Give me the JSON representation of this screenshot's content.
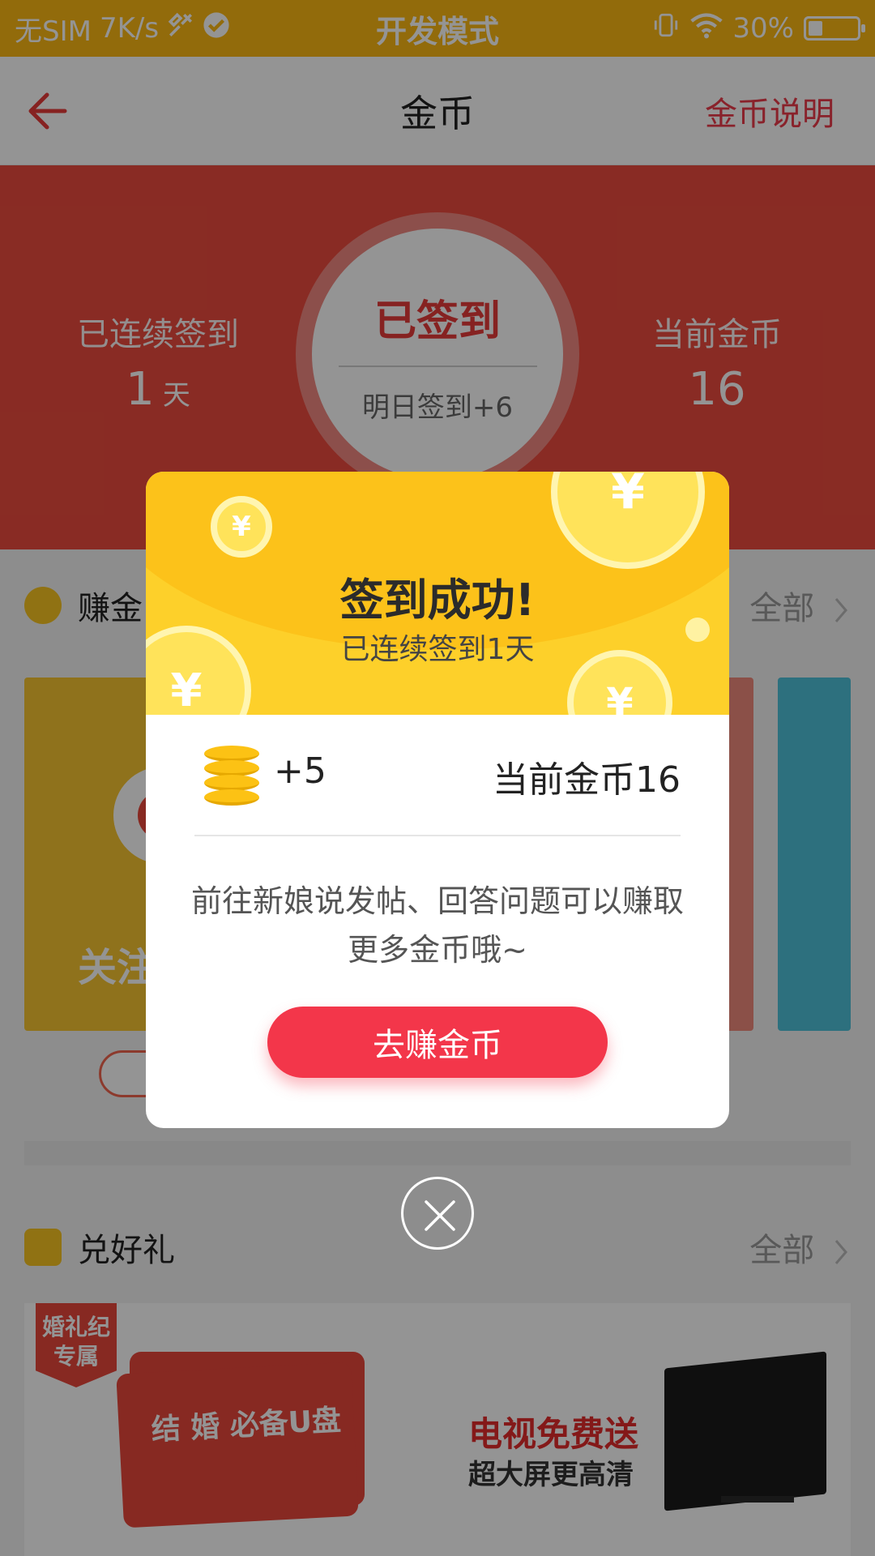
{
  "status_bar": {
    "carrier": "无SIM",
    "speed": "7K/s",
    "mode": "开发模式",
    "battery": "30%",
    "battery_level": 0.3
  },
  "nav": {
    "title": "金币",
    "right_link": "金币说明"
  },
  "hero": {
    "streak_label": "已连续签到",
    "streak_value": "1",
    "streak_unit": "天",
    "signed_text": "已签到",
    "tomorrow_text": "明日签到+6",
    "coins_label": "当前金币",
    "coins_value": "16"
  },
  "earn_section": {
    "title": "赚金",
    "all_label": "全部",
    "card_label": "关注"
  },
  "gift_section": {
    "title": "兑好礼",
    "all_label": "全部",
    "badge_text": "婚礼纪专属",
    "ticket_text": "结 婚 必备U盘",
    "tv_title": "电视免费送",
    "tv_subtitle": "超大屏更高清"
  },
  "dialog": {
    "title": "签到成功!",
    "subtitle": "已连续签到1天",
    "reward": "+5",
    "current_coins": "当前金币16",
    "description": "前往新娘说发帖、回答问题可以赚取更多金币哦~",
    "button_label": "去赚金币"
  },
  "colors": {
    "status_bar": "#fcb813",
    "accent_red": "#ec3b4a",
    "hero_red": "#ec4b3e",
    "dialog_yellow": "#fdd02a",
    "button_red": "#f3364a"
  },
  "icons": [
    "back-arrow-icon",
    "wrench-icon",
    "check-icon",
    "vibrate-icon",
    "wifi-icon",
    "battery-icon",
    "coin-icon",
    "gift-icon",
    "chevron-right-icon",
    "coin-stack-icon",
    "close-icon"
  ]
}
